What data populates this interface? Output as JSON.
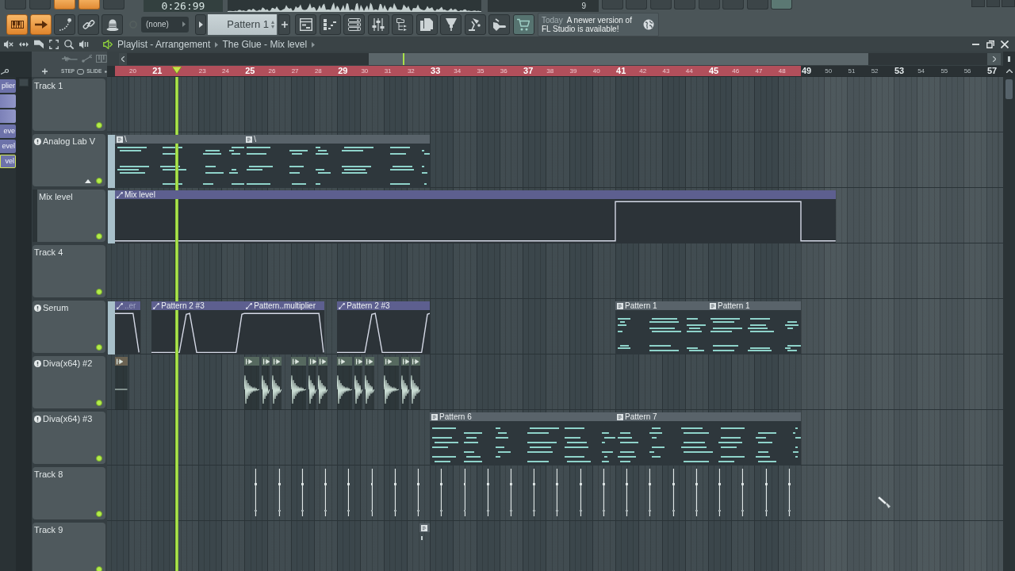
{
  "top_bar": {
    "toggles": [
      {
        "on": false
      },
      {
        "on": false
      },
      {
        "on": true
      },
      {
        "on": true
      },
      {
        "on": false
      }
    ],
    "time": "0:26:99",
    "counter": "9"
  },
  "toolbar": {
    "toggles": [
      {
        "on": true
      },
      {
        "on": true
      },
      {
        "on": false
      },
      {
        "on": false
      },
      {
        "on": false
      }
    ],
    "preset": "(none)",
    "pattern": "Pattern 1",
    "news": {
      "when": "Today",
      "lines": [
        "A newer version of",
        "FL Studio is available!"
      ]
    }
  },
  "playlist": {
    "title": "Playlist - Arrangement",
    "path": "The Glue - Mix level",
    "snap": [
      "STEP",
      "SLIDE"
    ],
    "slide": false
  },
  "browser": [
    {
      "label": "plier",
      "selected": false
    },
    {
      "selected": false
    },
    {
      "selected": false
    },
    {
      "label": "eve",
      "selected": false
    },
    {
      "label": "evel",
      "selected": false
    },
    {
      "label": "vel",
      "selected": true
    }
  ],
  "ruler": [
    {
      "label": "20",
      "major": false
    },
    {
      "label": "21",
      "major": true
    },
    {
      "label": "23",
      "major": false
    },
    {
      "label": "24",
      "major": false
    },
    {
      "label": "25",
      "major": true
    },
    {
      "label": "26",
      "major": false
    },
    {
      "label": "27",
      "major": false
    },
    {
      "label": "28",
      "major": false
    },
    {
      "label": "29",
      "major": true
    },
    {
      "label": "30",
      "major": false
    },
    {
      "label": "31",
      "major": false
    },
    {
      "label": "32",
      "major": false
    },
    {
      "label": "33",
      "major": true
    },
    {
      "label": "34",
      "major": false
    },
    {
      "label": "35",
      "major": false
    },
    {
      "label": "36",
      "major": false
    },
    {
      "label": "37",
      "major": true
    },
    {
      "label": "38",
      "major": false
    },
    {
      "label": "39",
      "major": false
    },
    {
      "label": "40",
      "major": false
    },
    {
      "label": "41",
      "major": true
    },
    {
      "label": "42",
      "major": false
    },
    {
      "label": "43",
      "major": false
    },
    {
      "label": "44",
      "major": false
    },
    {
      "label": "45",
      "major": true
    },
    {
      "label": "46",
      "major": false
    },
    {
      "label": "47",
      "major": false
    },
    {
      "label": "48",
      "major": false
    },
    {
      "label": "49",
      "major": true
    },
    {
      "label": "50",
      "major": false
    },
    {
      "label": "51",
      "major": false
    },
    {
      "label": "52",
      "major": false
    },
    {
      "label": "53",
      "major": true
    },
    {
      "label": "54",
      "major": false
    },
    {
      "label": "55",
      "major": false
    },
    {
      "label": "56",
      "major": false
    },
    {
      "label": "57",
      "major": true
    }
  ],
  "tracks": [
    {
      "name": "Track 1",
      "kind": "normal",
      "linked": false,
      "expanded": false,
      "enabled": true
    },
    {
      "name": "Analog Lab V",
      "kind": "normal",
      "linked": true,
      "expanded": true,
      "enabled": true,
      "clips": [
        {
          "kind": "pattern",
          "label": "\\"
        },
        {
          "kind": "pattern",
          "label": "\\"
        }
      ]
    },
    {
      "name": "Mix level",
      "kind": "automation",
      "linked": false,
      "expanded": false,
      "enabled": true,
      "clips": [
        {
          "kind": "automation",
          "label": "Mix level"
        }
      ]
    },
    {
      "name": "Track 4",
      "kind": "normal",
      "linked": false,
      "expanded": false,
      "enabled": true
    },
    {
      "name": "Serum",
      "kind": "normal",
      "linked": true,
      "expanded": false,
      "enabled": true,
      "clips": [
        {
          "kind": "automation",
          "label": "..er"
        },
        {
          "kind": "automation",
          "label": "Pattern 2 #3"
        },
        {
          "kind": "automation",
          "label": "Pattern..multiplier"
        },
        {
          "kind": "automation",
          "label": "Pattern 2 #3"
        },
        {
          "kind": "pattern",
          "label": "Pattern 1"
        },
        {
          "kind": "pattern",
          "label": "Pattern 1"
        }
      ]
    },
    {
      "name": "Diva(x64) #2",
      "kind": "normal",
      "linked": true,
      "expanded": false,
      "enabled": true,
      "clips": [
        {
          "kind": "audio"
        },
        {
          "kind": "audio"
        },
        {
          "kind": "audio"
        },
        {
          "kind": "audio"
        },
        {
          "kind": "audio"
        },
        {
          "kind": "audio"
        },
        {
          "kind": "audio"
        },
        {
          "kind": "audio"
        },
        {
          "kind": "audio"
        },
        {
          "kind": "audio"
        },
        {
          "kind": "audio"
        },
        {
          "kind": "audio"
        },
        {
          "kind": "audio"
        }
      ]
    },
    {
      "name": "Diva(x64) #3",
      "kind": "normal",
      "linked": true,
      "expanded": false,
      "enabled": true,
      "clips": [
        {
          "kind": "pattern",
          "label": "Pattern 6"
        },
        {
          "kind": "pattern",
          "label": "Pattern 7"
        }
      ]
    },
    {
      "name": "Track 8",
      "kind": "normal",
      "linked": false,
      "expanded": false,
      "enabled": true,
      "clips": [
        {
          "kind": "marker"
        },
        {
          "kind": "marker"
        },
        {
          "kind": "marker"
        },
        {
          "kind": "marker"
        },
        {
          "kind": "marker"
        },
        {
          "kind": "marker"
        },
        {
          "kind": "marker"
        },
        {
          "kind": "marker"
        },
        {
          "kind": "marker"
        },
        {
          "kind": "marker"
        },
        {
          "kind": "marker"
        },
        {
          "kind": "marker"
        },
        {
          "kind": "marker"
        },
        {
          "kind": "marker"
        },
        {
          "kind": "marker"
        },
        {
          "kind": "marker"
        },
        {
          "kind": "marker"
        },
        {
          "kind": "marker"
        },
        {
          "kind": "marker"
        },
        {
          "kind": "marker"
        },
        {
          "kind": "marker"
        },
        {
          "kind": "marker"
        },
        {
          "kind": "marker"
        },
        {
          "kind": "marker"
        }
      ]
    },
    {
      "name": "Track 9",
      "kind": "normal",
      "linked": false,
      "expanded": false,
      "enabled": true,
      "clips": [
        {
          "kind": "pattern"
        }
      ]
    }
  ]
}
